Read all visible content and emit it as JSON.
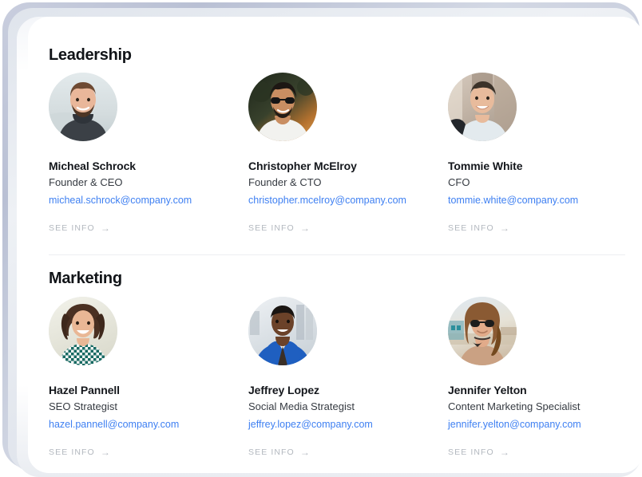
{
  "theme": {
    "page_bg": "#ffffff",
    "frame_color": "#c4cada",
    "heading_color": "#111418",
    "name_color": "#14171c",
    "role_color": "#363b42",
    "link_color": "#3f80f2",
    "muted_color": "#b3b8bf",
    "divider_color": "#eceef1"
  },
  "sections": [
    {
      "id": "leadership",
      "title": "Leadership",
      "people": [
        {
          "name": "Micheal Schrock",
          "role": "Founder & CEO",
          "email": "micheal.schrock@company.com",
          "cta": "SEE INFO",
          "cta_arrow": "→",
          "avatar_icon": "avatar-photo-micheal-schrock",
          "avatar_colors": {
            "bg_top": "#dfe6e9",
            "bg_bottom": "#cdd6d8",
            "skin": "#e9b79a",
            "hair": "#6e4a33",
            "clothing": "#3b4046"
          }
        },
        {
          "name": "Christopher McElroy",
          "role": "Founder & CTO",
          "email": "christopher.mcelroy@company.com",
          "cta": "SEE INFO",
          "cta_arrow": "→",
          "avatar_icon": "avatar-photo-christopher-mcelroy",
          "avatar_colors": {
            "bg_top": "#2b3326",
            "bg_bottom": "#b9722f",
            "skin": "#c98e62",
            "hair": "#1d1713",
            "clothing": "#f2f2ef"
          }
        },
        {
          "name": "Tommie White",
          "role": "CFO",
          "email": "tommie.white@company.com",
          "cta": "SEE INFO",
          "cta_arrow": "→",
          "avatar_icon": "avatar-photo-tommie-white",
          "avatar_colors": {
            "bg_top": "#cbbfb4",
            "bg_bottom": "#b4a699",
            "skin": "#e8bb9c",
            "hair": "#3b3229",
            "clothing": "#dfe6ea"
          }
        }
      ]
    },
    {
      "id": "marketing",
      "title": "Marketing",
      "people": [
        {
          "name": "Hazel Pannell",
          "role": "SEO Strategist",
          "email": "hazel.pannell@company.com",
          "cta": "SEE INFO",
          "cta_arrow": "→",
          "avatar_icon": "avatar-photo-hazel-pannell",
          "avatar_colors": {
            "bg_top": "#eeeee6",
            "bg_bottom": "#e2e2d6",
            "skin": "#e9b795",
            "hair": "#4a3022",
            "clothing": "#176a63"
          }
        },
        {
          "name": "Jeffrey Lopez",
          "role": "Social Media Strategist",
          "email": "jeffrey.lopez@company.com",
          "cta": "SEE INFO",
          "cta_arrow": "→",
          "avatar_icon": "avatar-photo-jeffrey-lopez",
          "avatar_colors": {
            "bg_top": "#e8ebee",
            "bg_bottom": "#cfd6dc",
            "skin": "#6b4229",
            "hair": "#1a1512",
            "clothing": "#1f5fc0"
          }
        },
        {
          "name": "Jennifer Yelton",
          "role": "Content Marketing Specialist",
          "email": "jennifer.yelton@company.com",
          "cta": "SEE INFO",
          "cta_arrow": "→",
          "avatar_icon": "avatar-photo-jennifer-yelton",
          "avatar_colors": {
            "bg_top": "#dfe7ef",
            "bg_bottom": "#d8cdbd",
            "skin": "#e2ab8a",
            "hair": "#8a5a33",
            "clothing": "#caa183"
          }
        }
      ]
    }
  ]
}
